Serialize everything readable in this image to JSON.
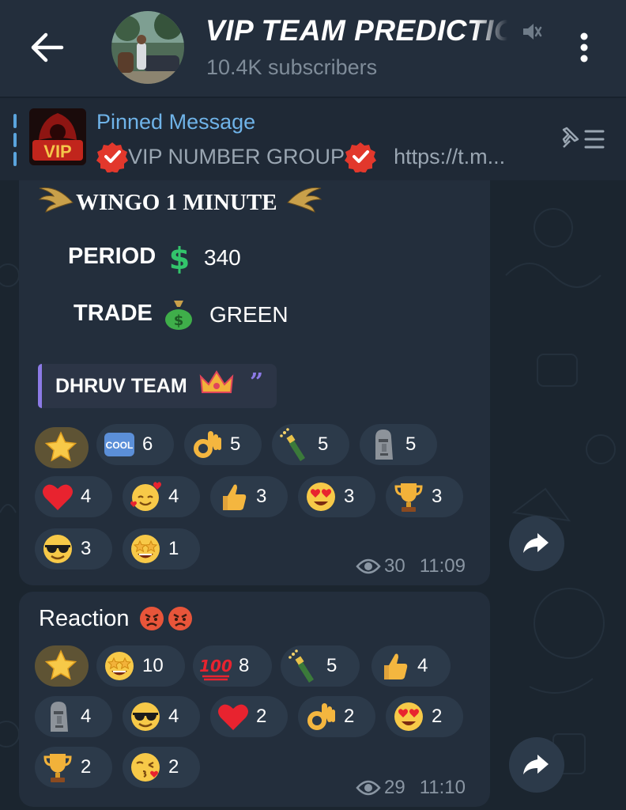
{
  "header": {
    "title": "VIP TEAM PREDICTIC",
    "subscribers": "10.4K subscribers"
  },
  "pinned": {
    "label": "Pinned Message",
    "text_name": "VIP NUMBER GROUP",
    "text_link": "https://t.m...",
    "thumb_text": "VIP"
  },
  "message1": {
    "title": "WINGO 1 MINUTE",
    "period_label": "PERIOD",
    "period_value": "340",
    "trade_label": "TRADE",
    "trade_value": "GREEN",
    "quote": "DHRUV TEAM",
    "reactions": [
      {
        "icon": "star-icon",
        "count": ""
      },
      {
        "icon": "cool-icon",
        "count": "6"
      },
      {
        "icon": "ok-hand-icon",
        "count": "5"
      },
      {
        "icon": "champagne-icon",
        "count": "5"
      },
      {
        "icon": "moai-icon",
        "count": "5"
      },
      {
        "icon": "heart-icon",
        "count": "4"
      },
      {
        "icon": "smiling-hearts-icon",
        "count": "4"
      },
      {
        "icon": "thumbs-up-icon",
        "count": "3"
      },
      {
        "icon": "heart-eyes-icon",
        "count": "3"
      },
      {
        "icon": "trophy-icon",
        "count": "3"
      },
      {
        "icon": "sunglasses-icon",
        "count": "3"
      },
      {
        "icon": "star-struck-icon",
        "count": "1"
      }
    ],
    "views": "30",
    "time": "11:09"
  },
  "message2": {
    "text": "Reaction",
    "reactions": [
      {
        "icon": "star-icon",
        "count": ""
      },
      {
        "icon": "star-struck-icon",
        "count": "10"
      },
      {
        "icon": "hundred-icon",
        "count": "8"
      },
      {
        "icon": "champagne-icon",
        "count": "5"
      },
      {
        "icon": "thumbs-up-icon",
        "count": "4"
      },
      {
        "icon": "moai-icon",
        "count": "4"
      },
      {
        "icon": "sunglasses-icon",
        "count": "4"
      },
      {
        "icon": "heart-icon",
        "count": "2"
      },
      {
        "icon": "ok-hand-icon",
        "count": "2"
      },
      {
        "icon": "heart-eyes-icon",
        "count": "2"
      },
      {
        "icon": "trophy-icon",
        "count": "2"
      },
      {
        "icon": "kiss-icon",
        "count": "2"
      }
    ],
    "views": "29",
    "time": "11:10"
  },
  "colors": {
    "header_bg": "#232e3c",
    "chat_bg": "#18222d",
    "bubble_bg": "#232e3c",
    "accent_blue": "#6fb3e8",
    "quote_accent": "#8c7ae6",
    "reaction_bg": "#2c3a4a",
    "reaction_selected_bg": "#5e5334"
  }
}
